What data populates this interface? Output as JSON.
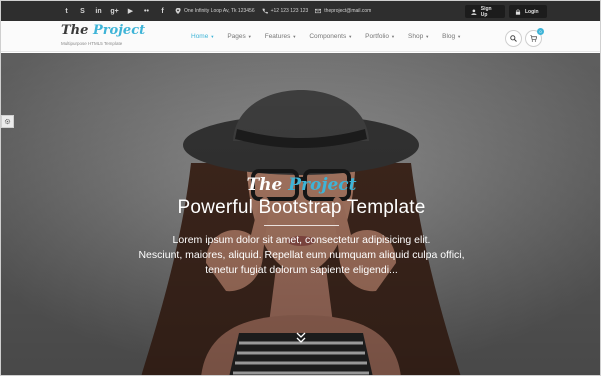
{
  "topbar": {
    "social": [
      "twitter-icon",
      "skype-icon",
      "linkedin-icon",
      "google-plus-icon",
      "youtube-icon",
      "flickr-icon",
      "facebook-icon",
      "pinterest-icon"
    ],
    "social_glyphs": [
      "t",
      "S",
      "in",
      "g+",
      "▶",
      "••",
      "f",
      "P"
    ],
    "address": "One Infinity Loop Av, Tk 123456",
    "phone": "+12 123 123 123",
    "email": "theproject@mail.com",
    "signup_label": "Sign Up",
    "login_label": "Login"
  },
  "header": {
    "logo_the": "The",
    "logo_project": "Project",
    "tagline": "Multipurpose HTML5 Template",
    "nav": [
      {
        "label": "Home",
        "active": true
      },
      {
        "label": "Pages",
        "active": false
      },
      {
        "label": "Features",
        "active": false
      },
      {
        "label": "Components",
        "active": false
      },
      {
        "label": "Portfolio",
        "active": false
      },
      {
        "label": "Shop",
        "active": false
      },
      {
        "label": "Blog",
        "active": false
      }
    ],
    "cart_count": "0"
  },
  "hero": {
    "logo_the": "The",
    "logo_project": "Project",
    "title": "Powerful Bootstrap Template",
    "line1": "Lorem ipsum dolor sit amet, consectetur adipisicing elit.",
    "line2": "Nesciunt, maiores, aliquid. Repellat eum numquam aliquid culpa offici,",
    "line3": "tenetur fugiat dolorum sapiente eligendi..."
  },
  "colors": {
    "accent": "#3eb4d7",
    "topbar": "#2e2e2e"
  }
}
